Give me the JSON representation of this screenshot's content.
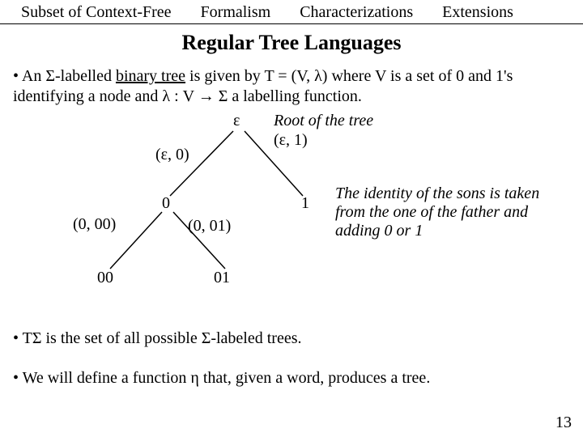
{
  "tabs": {
    "a": "Subset of Context-Free",
    "b": "Formalism",
    "c": "Characterizations",
    "d": "Extensions"
  },
  "title": "Regular Tree Languages",
  "para1_a": "• An Σ-labelled ",
  "para1_b": "binary tree",
  "para1_c": " is given by T = (V, λ) where V is a set of 0 and 1's identifying a node and λ : V → Σ a labelling function.",
  "tree": {
    "eps": "ε",
    "edge_eps0": "(ε, 0)",
    "edge_eps1": "(ε, 1)",
    "n0": "0",
    "n1": "1",
    "edge_0_00": "(0, 00)",
    "edge_0_01": "(0, 01)",
    "n00": "00",
    "n01": "01"
  },
  "anno_root": "Root of the tree",
  "anno_sons": "The identity of the sons is taken from the one of the father and adding 0 or 1",
  "para2": "• TΣ is the set of all possible Σ-labeled trees.",
  "para3": "• We will define a function η that, given a word, produces a tree.",
  "pagenum": "13"
}
